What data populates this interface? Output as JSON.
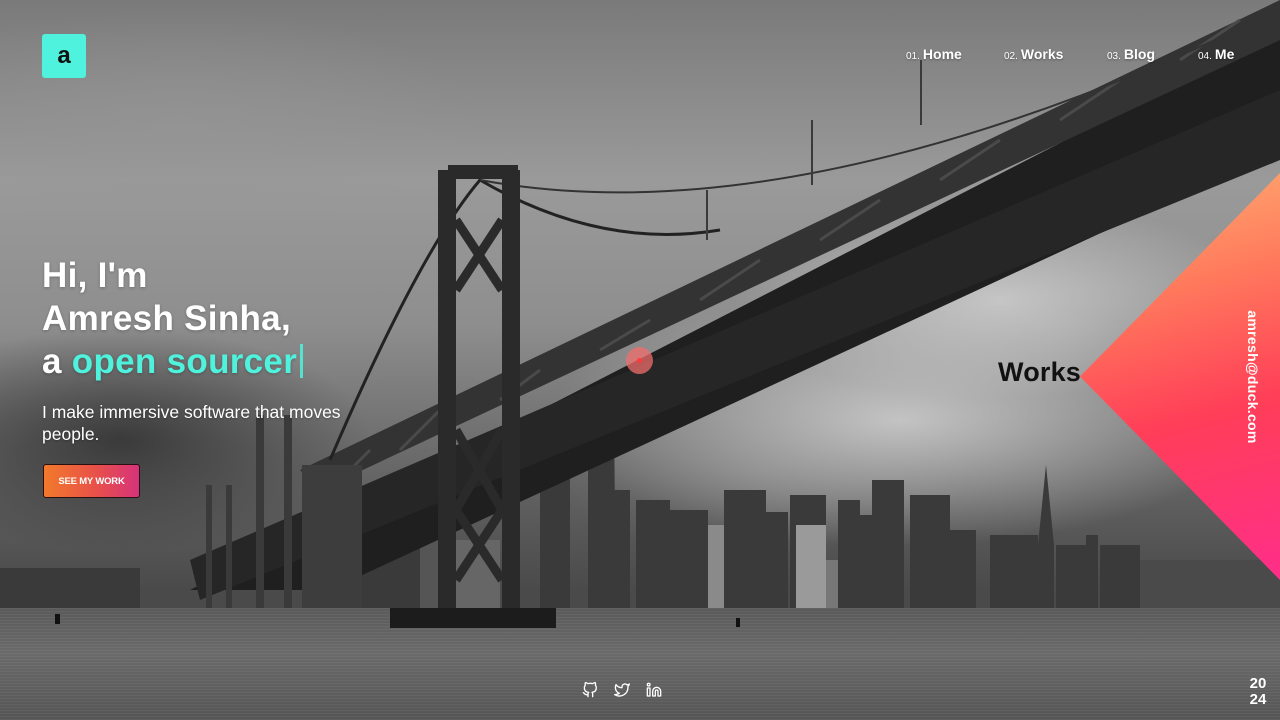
{
  "logo": {
    "letter": "a",
    "color": "#4ff2dc"
  },
  "nav": {
    "items": [
      {
        "num": "01.",
        "label": "Home"
      },
      {
        "num": "02.",
        "label": "Works"
      },
      {
        "num": "03.",
        "label": "Blog"
      },
      {
        "num": "04.",
        "label": "Me"
      }
    ]
  },
  "hero": {
    "line1": "Hi, I'm",
    "line2": "Amresh Sinha,",
    "line3_prefix": "a",
    "line3_accent": "open sourcer",
    "tagline": "I make immersive software that moves people.",
    "cta_label": "SEE MY WORK",
    "accent_color": "#4ff2dc"
  },
  "side": {
    "works_label": "Works",
    "email": "amresh@duck.com",
    "gradient_colors": [
      "#ffb274",
      "#ff3e58",
      "#ff2e8a"
    ]
  },
  "socials": [
    {
      "icon": "github-icon"
    },
    {
      "icon": "twitter-icon"
    },
    {
      "icon": "linkedin-icon"
    }
  ],
  "footer": {
    "year_top": "20",
    "year_bottom": "24"
  }
}
